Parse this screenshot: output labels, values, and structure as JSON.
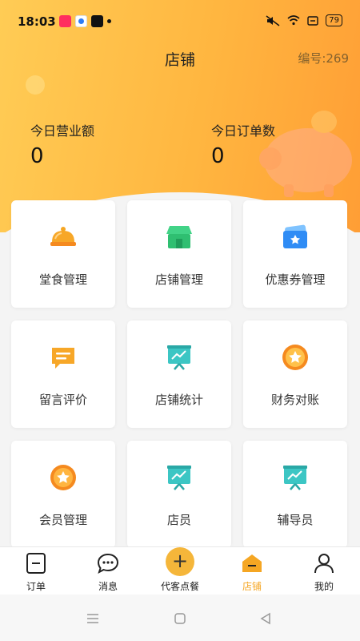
{
  "status": {
    "time": "18:03",
    "battery": "79"
  },
  "header": {
    "title": "店铺",
    "store_no": "编号:269"
  },
  "stats": {
    "revenue_label": "今日营业额",
    "revenue_value": "0",
    "orders_label": "今日订单数",
    "orders_value": "0"
  },
  "grid": [
    {
      "label": "堂食管理",
      "icon": "cloche-icon"
    },
    {
      "label": "店铺管理",
      "icon": "storefront-icon"
    },
    {
      "label": "优惠券管理",
      "icon": "coupon-icon"
    },
    {
      "label": "留言评价",
      "icon": "message-icon"
    },
    {
      "label": "店铺统计",
      "icon": "stats-board-icon"
    },
    {
      "label": "财务对账",
      "icon": "star-medal-icon"
    },
    {
      "label": "会员管理",
      "icon": "member-medal-icon"
    },
    {
      "label": "店员",
      "icon": "clerk-board-icon"
    },
    {
      "label": "辅导员",
      "icon": "tutor-board-icon"
    }
  ],
  "tabs": [
    {
      "label": "订单",
      "icon": "order-icon"
    },
    {
      "label": "消息",
      "icon": "chat-icon"
    },
    {
      "label": "代客点餐",
      "icon": "plus-icon"
    },
    {
      "label": "店铺",
      "icon": "shop-icon",
      "active": true
    },
    {
      "label": "我的",
      "icon": "user-icon"
    }
  ],
  "colors": {
    "accent": "#f5a623",
    "hero_start": "#ffcc55",
    "hero_end": "#ff9e35"
  }
}
